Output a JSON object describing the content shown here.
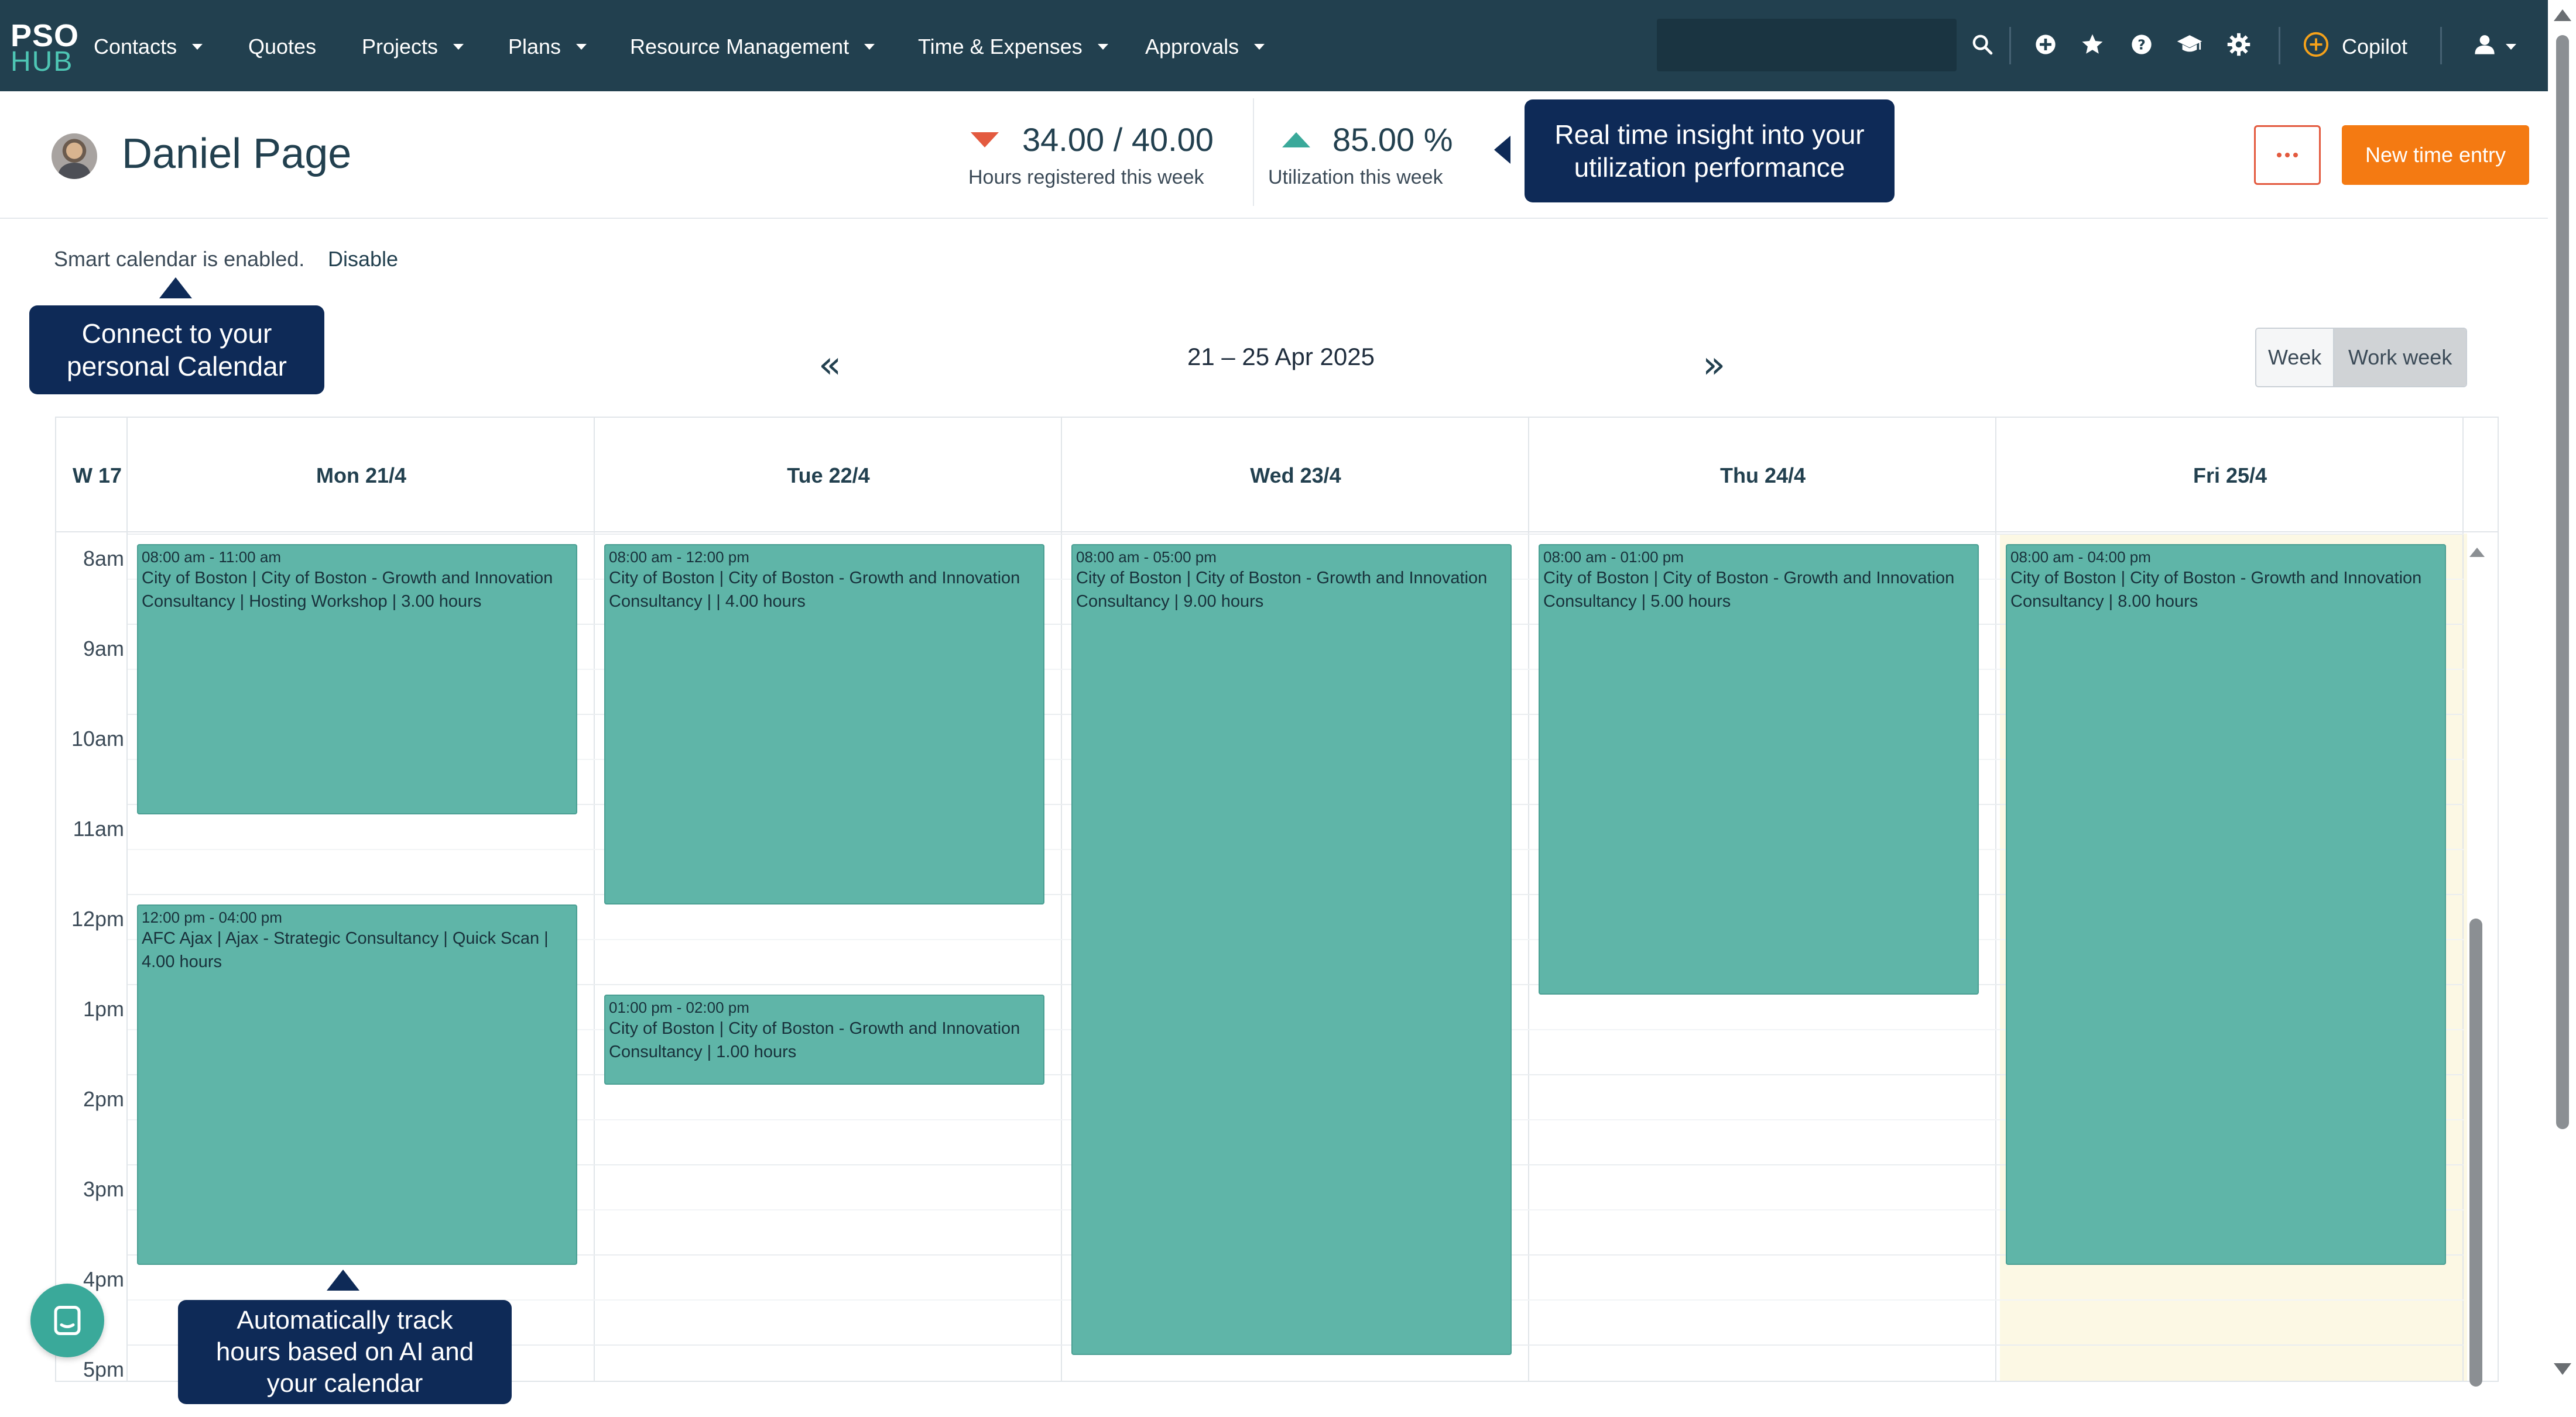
{
  "nav": {
    "logo_top": "PSO",
    "logo_bottom": "HUB",
    "items": [
      {
        "label": "Contacts"
      },
      {
        "label": "Quotes"
      },
      {
        "label": "Projects"
      },
      {
        "label": "Plans"
      },
      {
        "label": "Resource Management"
      },
      {
        "label": "Time & Expenses"
      },
      {
        "label": "Approvals"
      }
    ],
    "search_placeholder": "",
    "copilot_label": "Copilot",
    "icons": [
      "search-icon",
      "plus-circle-icon",
      "star-icon",
      "help-icon",
      "graduation-cap-icon",
      "gear-icon",
      "copilot-icon",
      "user-icon"
    ]
  },
  "header": {
    "user_name": "Daniel Page",
    "hours_value": "34.00 / 40.00",
    "hours_label": "Hours registered this week",
    "utilization_value": "85.00 %",
    "utilization_label": "Utilization this week",
    "tooltip_insight_line1": "Real time insight into your",
    "tooltip_insight_line2": "utilization performance",
    "more_icon": "ellipsis-icon",
    "new_entry_label": "New time entry"
  },
  "smart_calendar": {
    "status_text": "Smart calendar is enabled.",
    "disable_label": "Disable",
    "tooltip_line1": "Connect to your",
    "tooltip_line2": "personal Calendar"
  },
  "date_nav": {
    "range": "21 – 25 Apr 2025",
    "prev_icon": "double-chevron-left-icon",
    "next_icon": "double-chevron-right-icon",
    "view_week": "Week",
    "view_work_week": "Work week",
    "selected_view": "Work week"
  },
  "calendar": {
    "week_label": "W 17",
    "days": [
      "Mon 21/4",
      "Tue 22/4",
      "Wed 23/4",
      "Thu 24/4",
      "Fri 25/4"
    ],
    "hours": [
      "8am",
      "9am",
      "10am",
      "11am",
      "12pm",
      "1pm",
      "2pm",
      "3pm",
      "4pm",
      "5pm"
    ],
    "events": [
      {
        "day": 0,
        "start": 8,
        "end": 11,
        "time": "08:00 am - 11:00 am",
        "desc": "City of Boston | City of Boston - Growth and Innovation Consultancy | Hosting Workshop | 3.00 hours"
      },
      {
        "day": 0,
        "start": 12,
        "end": 16,
        "time": "12:00 pm - 04:00 pm",
        "desc": "AFC Ajax | Ajax - Strategic Consultancy | Quick Scan | 4.00 hours"
      },
      {
        "day": 1,
        "start": 8,
        "end": 12,
        "time": "08:00 am - 12:00 pm",
        "desc": "City of Boston | City of Boston - Growth and Innovation Consultancy | | 4.00 hours"
      },
      {
        "day": 1,
        "start": 13,
        "end": 14,
        "time": "01:00 pm - 02:00 pm",
        "desc": "City of Boston | City of Boston - Growth and Innovation Consultancy | 1.00 hours"
      },
      {
        "day": 2,
        "start": 8,
        "end": 17,
        "time": "08:00 am - 05:00 pm",
        "desc": "City of Boston | City of Boston - Growth and Innovation Consultancy | 9.00 hours"
      },
      {
        "day": 3,
        "start": 8,
        "end": 13,
        "time": "08:00 am - 01:00 pm",
        "desc": "City of Boston | City of Boston - Growth and Innovation Consultancy | 5.00 hours"
      },
      {
        "day": 4,
        "start": 8,
        "end": 16,
        "time": "08:00 am - 04:00 pm",
        "desc": "City of Boston | City of Boston - Growth and Innovation Consultancy | 8.00 hours"
      }
    ]
  },
  "footer": {
    "tooltip_line1": "Automatically track",
    "tooltip_line2": "hours based on AI and",
    "tooltip_line3": "your calendar",
    "chat_icon": "chat-icon"
  },
  "colors": {
    "navbar": "#22404f",
    "accent_orange": "#f47a12",
    "event": "#5fb5a8",
    "tooltip": "#0e2a57",
    "trend_down": "#e35a3f",
    "trend_up": "#3aa99a"
  }
}
